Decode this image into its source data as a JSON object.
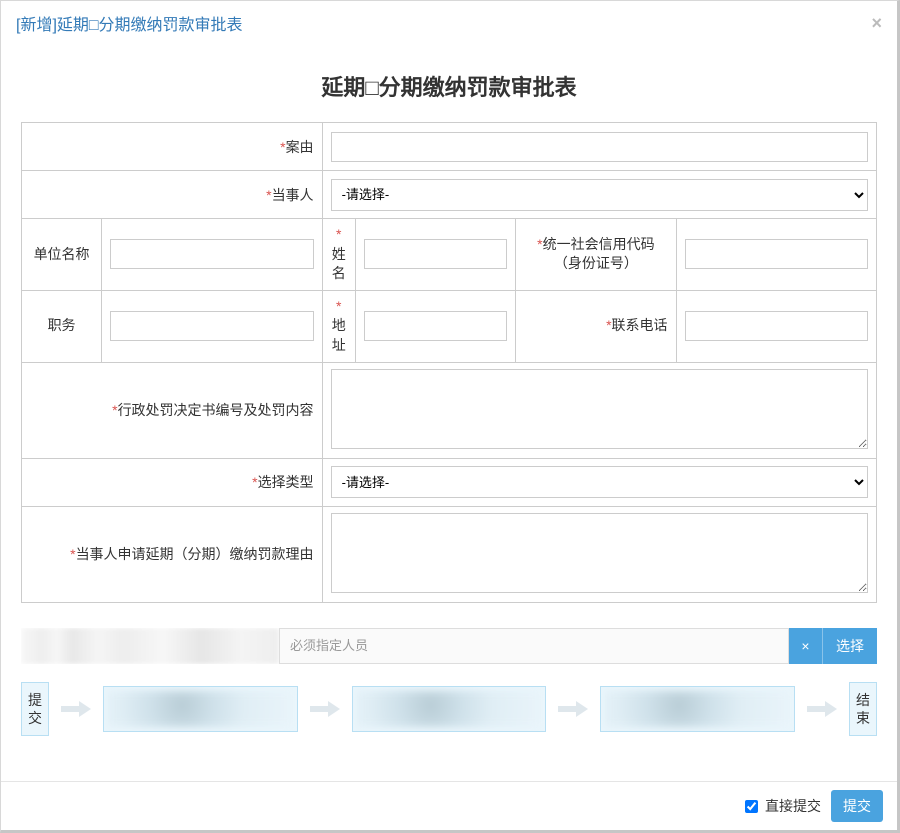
{
  "header": {
    "title": "[新增]延期□分期缴纳罚款审批表"
  },
  "form": {
    "title": "延期□分期缴纳罚款审批表",
    "labels": {
      "case_reason": "案由",
      "party": "当事人",
      "unit_name": "单位名称",
      "name": "姓名",
      "uscc": "统一社会信用代码（身份证号）",
      "position": "职务",
      "address": "地址",
      "phone": "联系电话",
      "decision_content": "行政处罚决定书编号及处罚内容",
      "select_type": "选择类型",
      "apply_reason": "当事人申请延期（分期）缴纳罚款理由"
    },
    "select_placeholder": "-请选择-",
    "values": {
      "case_reason": "",
      "unit_name": "",
      "name": "",
      "uscc": "",
      "position": "",
      "address": "",
      "phone": "",
      "decision_content": "",
      "apply_reason": ""
    }
  },
  "assignee": {
    "placeholder": "必须指定人员",
    "clear_label": "×",
    "select_label": "选择"
  },
  "flow": {
    "start": "提交",
    "end": "结束"
  },
  "footer": {
    "direct_submit_label": "直接提交",
    "direct_submit_checked": true,
    "submit_label": "提交"
  }
}
